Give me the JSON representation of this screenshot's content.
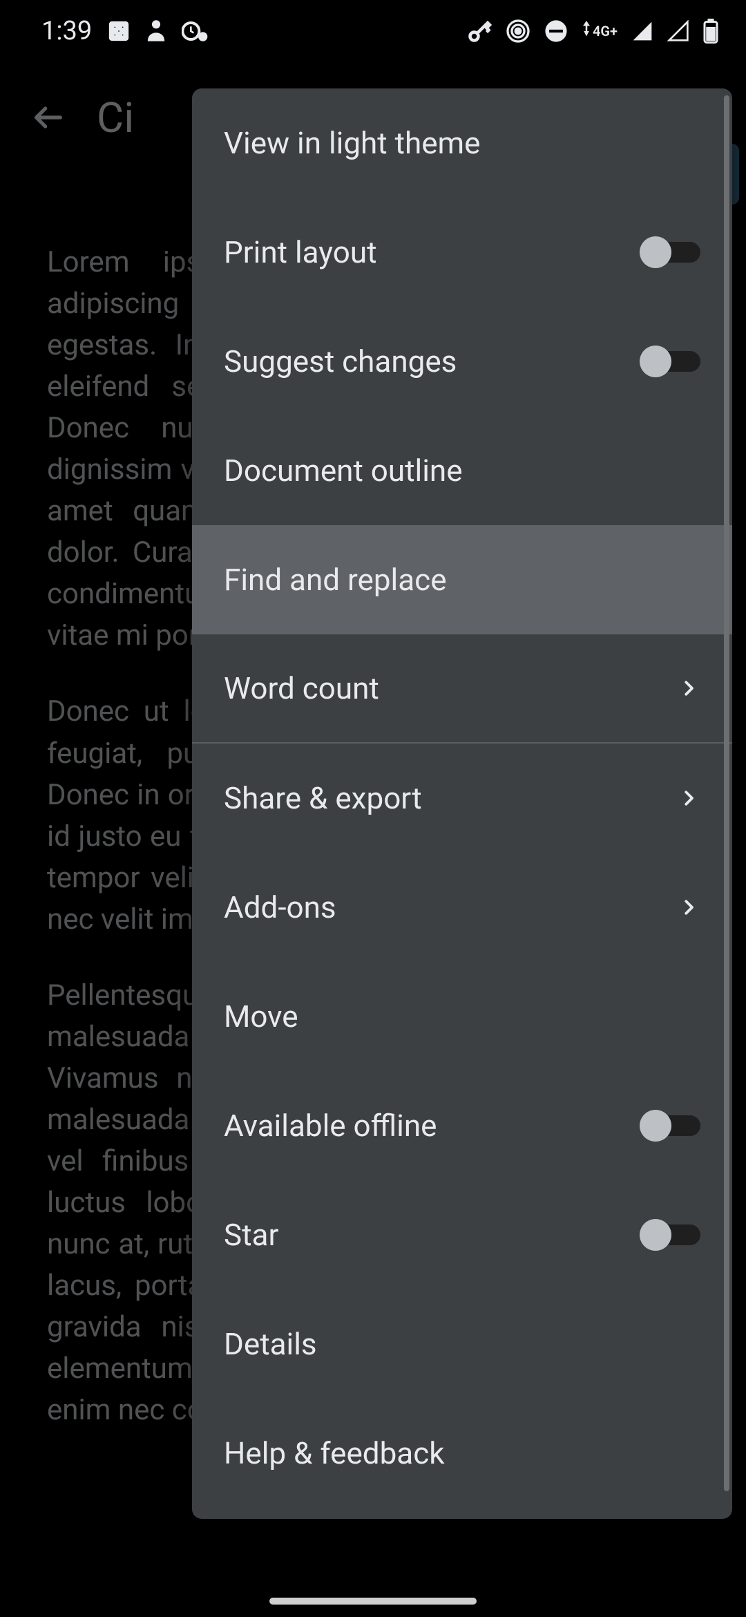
{
  "status_bar": {
    "time": "1:39",
    "network_label": "4G+"
  },
  "app": {
    "doc_title_fragment": "Ci",
    "paragraphs": [
      "Lorem ipsum dolor sit amet, consectetur adipiscing elit. Sed vitae nisl ac orci volutpat egestas. Integer ullamcorper efficitur augue, in eleifend sem sagittis lectus dapibus facilisis. Donec nulla vitae, commodo purus. Nunc dignissim viverra quam, nec cursus sem. Etiam sit amet quam diam. Vivamus sit amet tincidunt dolor. Curabitur vehicula eu aliquam. Vestibulum condimentum lobortis metus at lacinia. Nullam vitae mi porttitor.",
      "Donec ut lorem, ac nunc. Maecenas eget tortor feugiat, pulvinar mauris gravida, lorem nulla. Donec in orci auctor risus feugiat vulputate. Donec id justo eu feugiat. Maecenas sed ipsum massa ut tempor velit in ipsum commodo. Nam sed augue nec velit imperdiet suscipit.",
      "Pellentesque tortor. Donec vitae enim et netus et malesuada fames. Nam quis Quisque lorem. Vivamus nec, rhoncus nec mauris non, aliquet malesuada orci. Nunc nunc nunc sit amet enim, vel finibus velit porta in. Praesent facilisis ex luctus lobortis. Vestibulum imperdiet, tincidunt nunc at, rutrum neque metus placerat, aliquet eros lacus, porta eu, dictum sit amet turpis. Nunc eu gravida nisi. Ut blandit tincidunt quam, varius elementum ante sagittis id. Maecenas pretium enim nec condimentum"
    ]
  },
  "menu": {
    "items": [
      {
        "key": "view-light-theme",
        "label": "View in light theme",
        "type": "plain"
      },
      {
        "key": "print-layout",
        "label": "Print layout",
        "type": "toggle",
        "on": false
      },
      {
        "key": "suggest-changes",
        "label": "Suggest changes",
        "type": "toggle",
        "on": false
      },
      {
        "key": "document-outline",
        "label": "Document outline",
        "type": "plain"
      },
      {
        "key": "find-replace",
        "label": "Find and replace",
        "type": "plain",
        "highlight": true
      },
      {
        "key": "word-count",
        "label": "Word count",
        "type": "chevron",
        "divider_after": true
      },
      {
        "key": "share-export",
        "label": "Share & export",
        "type": "chevron"
      },
      {
        "key": "add-ons",
        "label": "Add-ons",
        "type": "chevron"
      },
      {
        "key": "move",
        "label": "Move",
        "type": "plain"
      },
      {
        "key": "available-offline",
        "label": "Available offline",
        "type": "toggle",
        "on": false
      },
      {
        "key": "star",
        "label": "Star",
        "type": "toggle",
        "on": false
      },
      {
        "key": "details",
        "label": "Details",
        "type": "plain"
      },
      {
        "key": "help-feedback",
        "label": "Help & feedback",
        "type": "plain"
      }
    ]
  }
}
